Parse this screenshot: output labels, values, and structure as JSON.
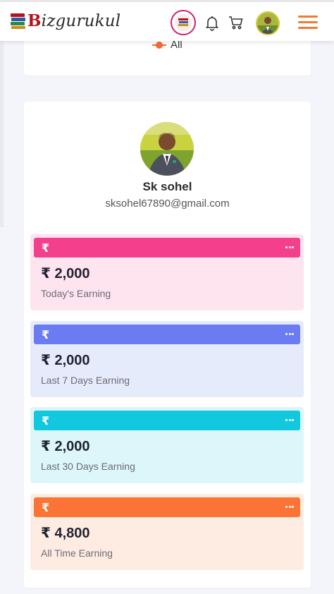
{
  "header": {
    "brand_first": "B",
    "brand_rest": "izgurukul",
    "icons": [
      "brand-badge-icon",
      "bell-icon",
      "cart-icon",
      "avatar",
      "menu-icon"
    ],
    "accent": "#f07a2f"
  },
  "chart_legend": {
    "label": "All",
    "color": "#f26a36"
  },
  "profile": {
    "name": "Sk sohel",
    "email": "sksohel67890@gmail.com"
  },
  "earnings": [
    {
      "currency_symbol": "₹",
      "amount": "₹ 2,000",
      "label": "Today's Earning",
      "head_color": "#f43f8c",
      "bg_color": "#fde4ef"
    },
    {
      "currency_symbol": "₹",
      "amount": "₹ 2,000",
      "label": "Last 7 Days Earning",
      "head_color": "#6b7cf2",
      "bg_color": "#e6ebfb"
    },
    {
      "currency_symbol": "₹",
      "amount": "₹ 2,000",
      "label": "Last 30 Days Earning",
      "head_color": "#11c8df",
      "bg_color": "#ddf6fa"
    },
    {
      "currency_symbol": "₹",
      "amount": "₹ 4,800",
      "label": "All Time Earning",
      "head_color": "#fb7436",
      "bg_color": "#feece3"
    }
  ]
}
